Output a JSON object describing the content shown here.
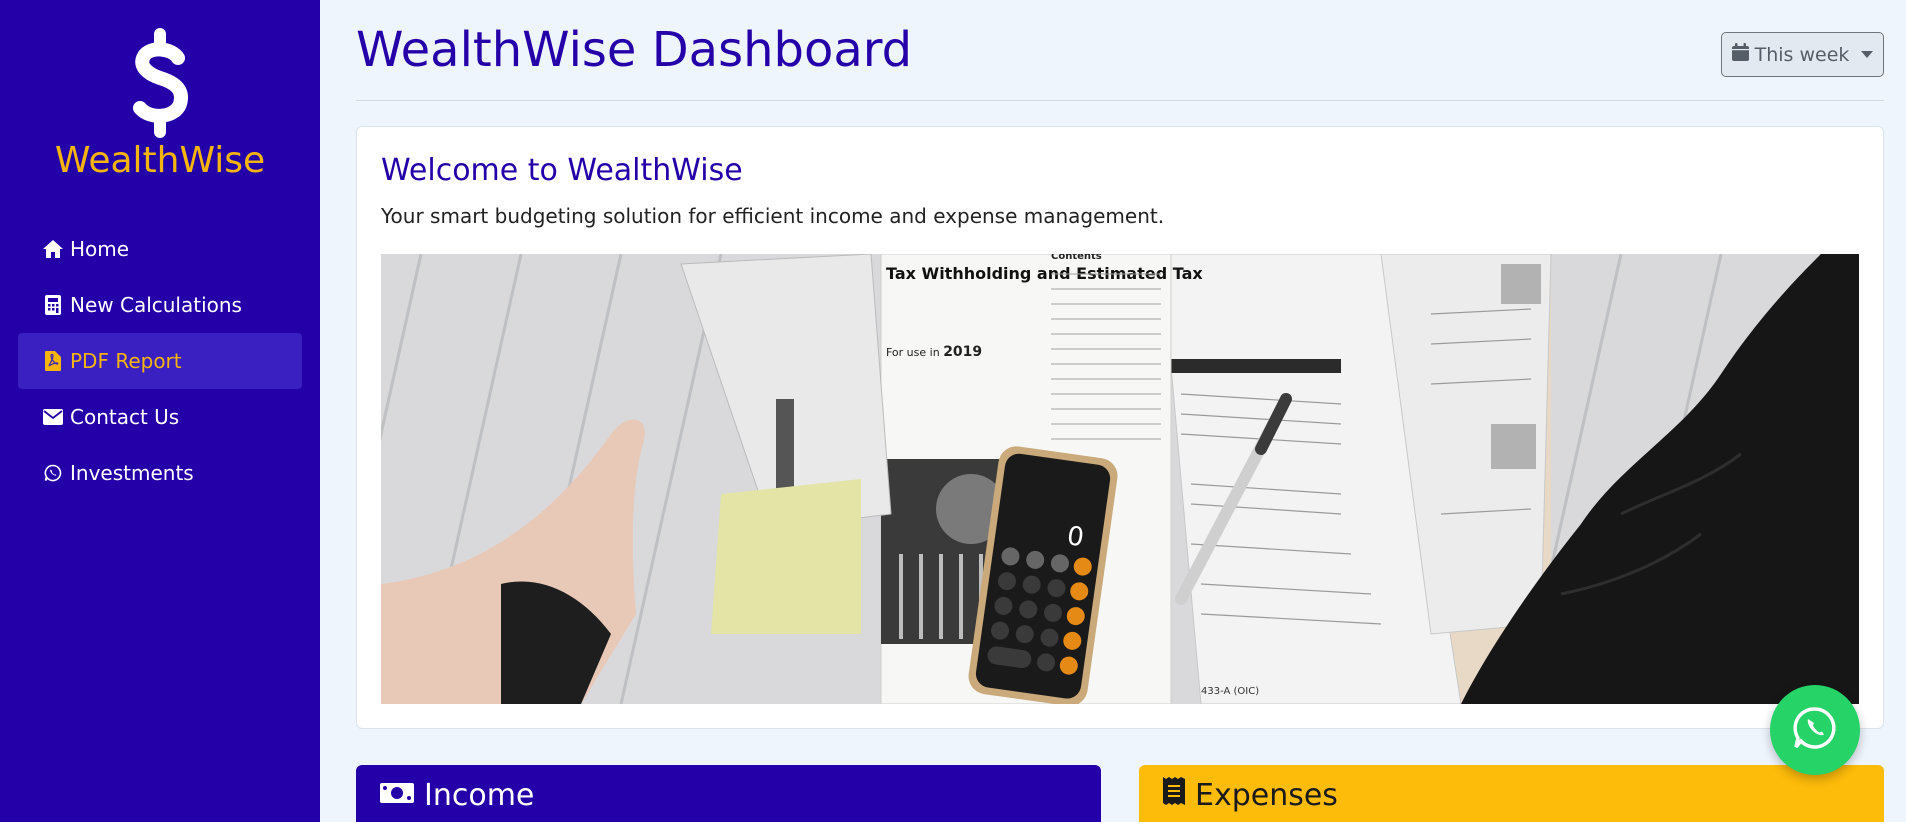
{
  "brand": {
    "name": "WealthWise",
    "logo_icon": "dollar-icon"
  },
  "sidebar": {
    "items": [
      {
        "label": "Home",
        "icon": "home-icon",
        "active": false
      },
      {
        "label": "New Calculations",
        "icon": "calculator-icon",
        "active": false
      },
      {
        "label": "PDF Report",
        "icon": "file-pdf-icon",
        "active": true
      },
      {
        "label": "Contact Us",
        "icon": "envelope-icon",
        "active": false
      },
      {
        "label": "Investments",
        "icon": "whatsapp-icon",
        "active": false
      }
    ]
  },
  "header": {
    "title": "WealthWise Dashboard",
    "range_button": {
      "label": "This week",
      "icon": "calendar-icon"
    }
  },
  "welcome": {
    "title": "Welcome to WealthWise",
    "subtitle": "Your smart budgeting solution for efficient income and expense management.",
    "hero": {
      "doc_title": "Tax Withholding and Estimated Tax",
      "doc_use": "For use in",
      "doc_year": "2019",
      "doc_contents": "Contents",
      "calc_display": "0",
      "form_code": "433-A (OIC)"
    }
  },
  "cards": {
    "income": {
      "label": "Income",
      "icon": "money-bill-icon"
    },
    "expenses": {
      "label": "Expenses",
      "icon": "receipt-icon"
    }
  },
  "floating": {
    "icon": "whatsapp-icon"
  },
  "colors": {
    "primary": "#2400a8",
    "accent": "#f6b40e",
    "warning": "#fdbb0a",
    "whatsapp": "#25d366"
  }
}
